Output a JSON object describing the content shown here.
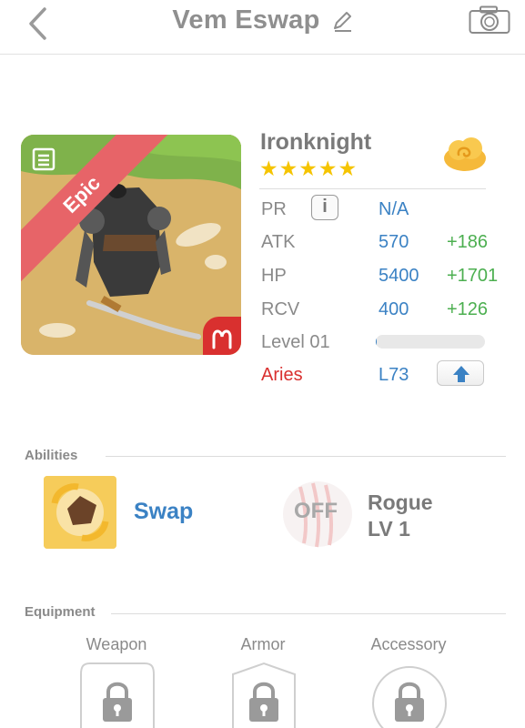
{
  "header": {
    "title": "Vem Eswap"
  },
  "card": {
    "rarity_badge": "Epic"
  },
  "hero": {
    "name": "Ironknight",
    "stars": "★★★★★",
    "star_count": 5
  },
  "stats": {
    "pr_label": "PR",
    "pr_value": "N/A",
    "info_label": "i",
    "atk_label": "ATK",
    "atk_value": "570",
    "atk_bonus": "+186",
    "hp_label": "HP",
    "hp_value": "5400",
    "hp_bonus": "+1701",
    "rcv_label": "RCV",
    "rcv_value": "400",
    "rcv_bonus": "+126",
    "level_label": "Level 01",
    "level_progress": 0.01,
    "sign_label": "Aries",
    "sign_level": "L73"
  },
  "abilities": {
    "section_title": "Abilities",
    "active_name": "Swap",
    "passive_state": "OFF",
    "passive_name": "Rogue",
    "passive_level": "LV 1"
  },
  "equipment": {
    "section_title": "Equipment",
    "slots": [
      "Weapon",
      "Armor",
      "Accessory"
    ]
  },
  "colors": {
    "accent_blue": "#3b82c4",
    "bonus_green": "#4caf50",
    "sign_red": "#d9302f",
    "epic_red": "#e76468",
    "star_gold": "#f5c400"
  },
  "icons": {
    "back": "chevron-left-icon",
    "edit": "pencil-icon",
    "camera": "camera-icon",
    "element": "cloud-icon",
    "info": "info-icon",
    "upgrade": "arrow-up-icon",
    "aries": "aries-icon",
    "lock": "lock-icon"
  }
}
